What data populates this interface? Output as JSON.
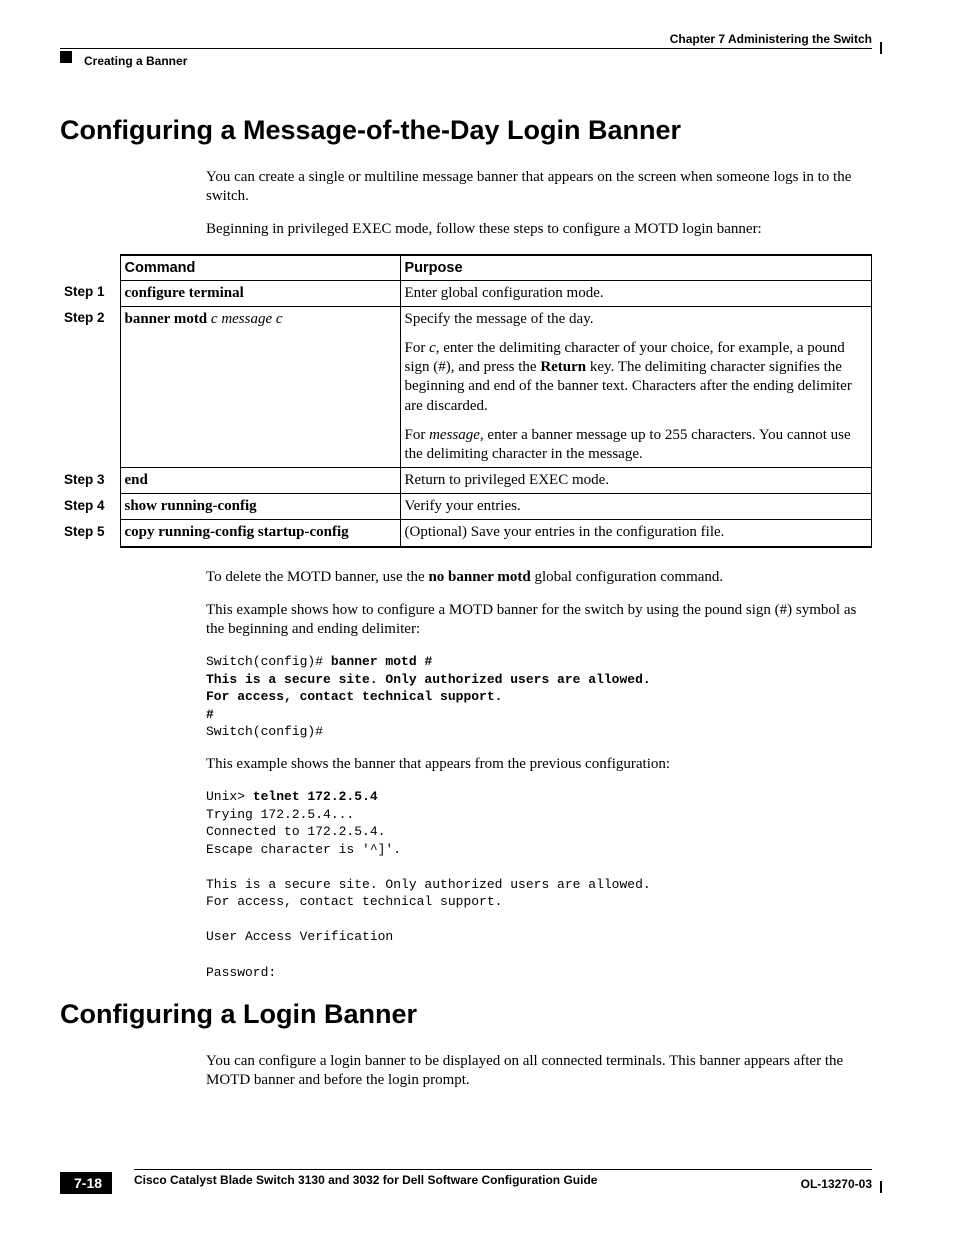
{
  "header": {
    "chapter": "Chapter 7      Administering the Switch",
    "crumb": "Creating a Banner"
  },
  "section1": {
    "title": "Configuring a Message-of-the-Day Login Banner",
    "p1": "You can create a single or multiline message banner that appears on the screen when someone logs in to the switch.",
    "p2": "Beginning in privileged EXEC mode, follow these steps to configure a MOTD login banner:"
  },
  "table": {
    "head_command": "Command",
    "head_purpose": "Purpose",
    "step1_label": "Step 1",
    "step1_cmd": "configure terminal",
    "step1_purpose": "Enter global configuration mode.",
    "step2_label": "Step 2",
    "step2_cmd_b": "banner motd ",
    "step2_cmd_i1": "c message c",
    "step2_p1": "Specify the message of the day.",
    "step2_p2_a": "For ",
    "step2_p2_ic": "c",
    "step2_p2_b": ", enter the delimiting character of your choice, for example, a pound sign (#), and press the ",
    "step2_p2_bold": "Return",
    "step2_p2_c": " key. The delimiting character signifies the beginning and end of the banner text. Characters after the ending delimiter are discarded.",
    "step2_p3_a": "For ",
    "step2_p3_im": "message",
    "step2_p3_b": ", enter a banner message up to 255 characters. You cannot use the delimiting character in the message.",
    "step3_label": "Step 3",
    "step3_cmd": "end",
    "step3_purpose": "Return to privileged EXEC mode.",
    "step4_label": "Step 4",
    "step4_cmd": "show running-config",
    "step4_purpose": "Verify your entries.",
    "step5_label": "Step 5",
    "step5_cmd": "copy running-config startup-config",
    "step5_purpose": "(Optional) Save your entries in the configuration file."
  },
  "after": {
    "p1_a": "To delete the MOTD banner, use the ",
    "p1_b": "no banner motd",
    "p1_c": " global configuration command.",
    "p2": "This example shows how to configure a MOTD banner for the switch by using the pound sign (#) symbol as the beginning and ending delimiter:",
    "code1_l1a": "Switch(config)# ",
    "code1_l1b": "banner motd #",
    "code1_l2": "This is a secure site. Only authorized users are allowed.",
    "code1_l3": "For access, contact technical support.",
    "code1_l4": "#",
    "code1_l5": "Switch(config)#",
    "p3": "This example shows the banner that appears from the previous configuration:",
    "code2_l1a": "Unix> ",
    "code2_l1b": "telnet 172.2.5.4",
    "code2_l2": "Trying 172.2.5.4...",
    "code2_l3": "Connected to 172.2.5.4.",
    "code2_l4": "Escape character is '^]'.",
    "code2_l5": "",
    "code2_l6": "This is a secure site. Only authorized users are allowed.",
    "code2_l7": "For access, contact technical support.",
    "code2_l8": "",
    "code2_l9": "User Access Verification",
    "code2_l10": "",
    "code2_l11": "Password:"
  },
  "section2": {
    "title": "Configuring a Login Banner",
    "p1": "You can configure a login banner to be displayed on all connected terminals. This banner appears after the MOTD banner and before the login prompt."
  },
  "footer": {
    "title": "Cisco Catalyst Blade Switch 3130 and 3032 for Dell Software Configuration Guide",
    "page": "7-18",
    "doc": "OL-13270-03"
  }
}
